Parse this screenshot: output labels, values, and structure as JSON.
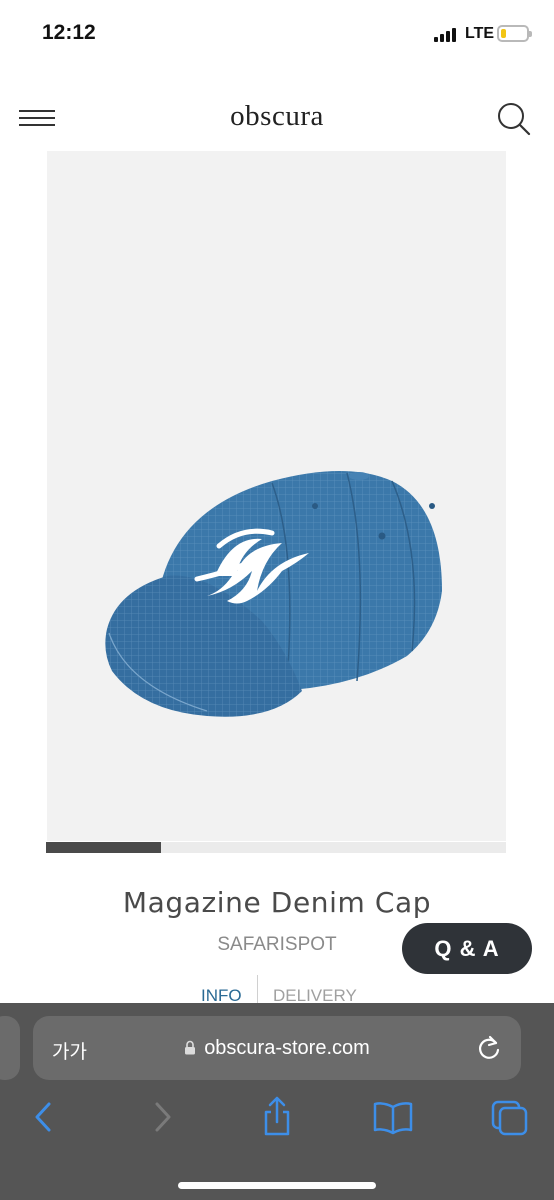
{
  "status_bar": {
    "time": "12:12",
    "network": "LTE",
    "battery_level": 0.2,
    "battery_color": "#f2c514"
  },
  "header": {
    "logo": "obscura",
    "menu_icon": "hamburger-menu-icon",
    "search_icon": "search-icon"
  },
  "product": {
    "image_description_icon": "product-photo",
    "carousel_progress": 0.25,
    "title": "Magazine Denim Cap",
    "brand": "SAFARISPOT"
  },
  "qa_button": {
    "label": "Q & A"
  },
  "tabs": [
    {
      "label": "INFO",
      "active": true
    },
    {
      "label": "DELIVERY",
      "active": false
    }
  ],
  "browser": {
    "text_size_label": "가가",
    "url": "obscura-store.com",
    "toolbar_icons": [
      "back-icon",
      "forward-icon",
      "share-icon",
      "bookmarks-icon",
      "tabs-icon"
    ]
  },
  "colors": {
    "accent": "#2a6a94",
    "cap_blue": "#3b78aa",
    "qa_bg": "#2f3338",
    "safari_bar": "#555555"
  }
}
